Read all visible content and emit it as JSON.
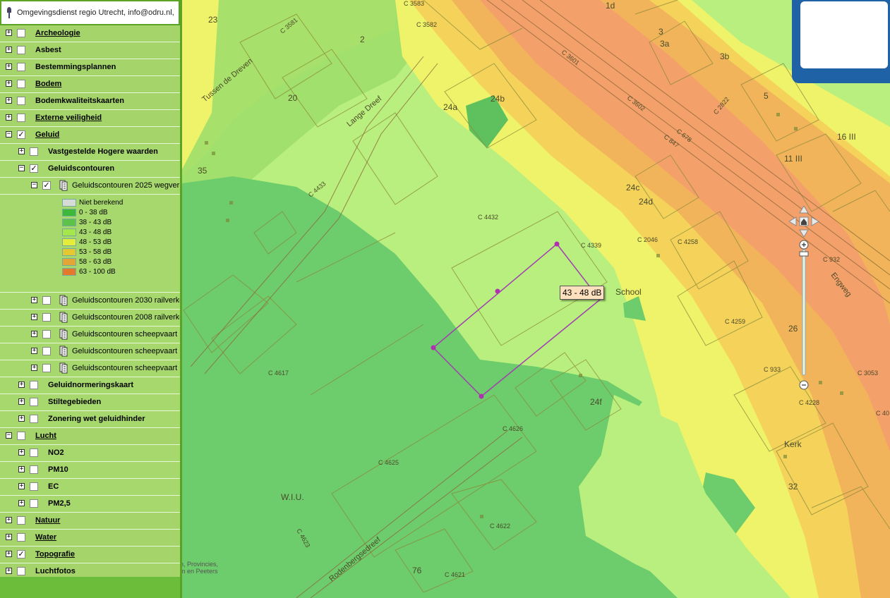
{
  "header": {
    "contact": "Omgevingsdienst regio Utrecht, info@odru.nl,"
  },
  "layers": [
    {
      "label": "Archeologie",
      "level": 0,
      "expand": "+",
      "checked": false,
      "underline": true
    },
    {
      "label": "Asbest",
      "level": 0,
      "expand": "+",
      "checked": false,
      "underline": false
    },
    {
      "label": "Bestemmingsplannen",
      "level": 0,
      "expand": "+",
      "checked": false,
      "underline": false
    },
    {
      "label": "Bodem",
      "level": 0,
      "expand": "+",
      "checked": false,
      "underline": true
    },
    {
      "label": "Bodemkwaliteitskaarten",
      "level": 0,
      "expand": "+",
      "checked": false,
      "underline": false
    },
    {
      "label": "Externe veiligheid",
      "level": 0,
      "expand": "+",
      "checked": false,
      "underline": true
    },
    {
      "label": "Geluid",
      "level": 0,
      "expand": "−",
      "checked": true,
      "underline": true
    },
    {
      "label": "Vastgestelde Hogere waarden",
      "level": 1,
      "expand": "+",
      "checked": false,
      "underline": false
    },
    {
      "label": "Geluidscontouren",
      "level": 1,
      "expand": "−",
      "checked": true,
      "underline": false
    },
    {
      "label": "Geluidscontouren 2025 wegverkeer",
      "level": 2,
      "expand": "−",
      "checked": true,
      "underline": false,
      "icon": true
    }
  ],
  "legend": [
    {
      "label": "Niet berekend",
      "color": "#d6dbd6"
    },
    {
      "label": "0 - 38 dB",
      "color": "#3db83a"
    },
    {
      "label": "38 - 43 dB",
      "color": "#5cc24a"
    },
    {
      "label": "43 - 48 dB",
      "color": "#a5e64a"
    },
    {
      "label": "48 - 53 dB",
      "color": "#e6ec3a"
    },
    {
      "label": "53 - 58 dB",
      "color": "#e3c832"
    },
    {
      "label": "58 - 63 dB",
      "color": "#e3a533"
    },
    {
      "label": "63 - 100 dB",
      "color": "#e37a2b"
    }
  ],
  "layers_after": [
    {
      "label": "Geluidscontouren 2030 railverkeer",
      "level": 2,
      "expand": "+",
      "checked": false,
      "underline": false,
      "icon": true
    },
    {
      "label": "Geluidscontouren 2008 railverkeer",
      "level": 2,
      "expand": "+",
      "checked": false,
      "underline": false,
      "icon": true
    },
    {
      "label": "Geluidscontouren scheepvaart",
      "level": 2,
      "expand": "+",
      "checked": false,
      "underline": false,
      "icon": true
    },
    {
      "label": "Geluidscontouren scheepvaart",
      "level": 2,
      "expand": "+",
      "checked": false,
      "underline": false,
      "icon": true
    },
    {
      "label": "Geluidscontouren scheepvaart",
      "level": 2,
      "expand": "+",
      "checked": false,
      "underline": false,
      "icon": true
    },
    {
      "label": "Geluidnormeringskaart",
      "level": 1,
      "expand": "+",
      "checked": false,
      "underline": false
    },
    {
      "label": "Stiltegebieden",
      "level": 1,
      "expand": "+",
      "checked": false,
      "underline": false
    },
    {
      "label": "Zonering wet geluidhinder",
      "level": 1,
      "expand": "+",
      "checked": false,
      "underline": false
    },
    {
      "label": "Lucht",
      "level": 0,
      "expand": "−",
      "checked": false,
      "underline": true
    },
    {
      "label": "NO2",
      "level": 1,
      "expand": "+",
      "checked": false,
      "underline": false
    },
    {
      "label": "PM10",
      "level": 1,
      "expand": "+",
      "checked": false,
      "underline": false
    },
    {
      "label": "EC",
      "level": 1,
      "expand": "+",
      "checked": false,
      "underline": false
    },
    {
      "label": "PM2,5",
      "level": 1,
      "expand": "+",
      "checked": false,
      "underline": false
    },
    {
      "label": "Natuur",
      "level": 0,
      "expand": "+",
      "checked": false,
      "underline": true
    },
    {
      "label": "Water",
      "level": 0,
      "expand": "+",
      "checked": false,
      "underline": true
    },
    {
      "label": "Topografie",
      "level": 0,
      "expand": "+",
      "checked": true,
      "underline": true
    },
    {
      "label": "Luchtfotos",
      "level": 0,
      "expand": "+",
      "checked": false,
      "underline": false
    }
  ],
  "attribution": {
    "line1": "en, Provincies,",
    "line2": "om en Peeters"
  },
  "measure_tooltip": "43 - 48 dB",
  "map_labels": [
    {
      "text": "23"
    },
    {
      "text": "C 3581"
    },
    {
      "text": "C 3583"
    },
    {
      "text": "C 3582"
    },
    {
      "text": "2"
    },
    {
      "text": "Tussen de Dreven"
    },
    {
      "text": "20"
    },
    {
      "text": "Lange Dreef"
    },
    {
      "text": "24a"
    },
    {
      "text": "24b"
    },
    {
      "text": "35"
    },
    {
      "text": "C 4433"
    },
    {
      "text": "C 4432"
    },
    {
      "text": "C 4339"
    },
    {
      "text": "C 2046"
    },
    {
      "text": "C 4258"
    },
    {
      "text": "24c"
    },
    {
      "text": "24d"
    },
    {
      "text": "School"
    },
    {
      "text": "C 4617"
    },
    {
      "text": "C 4259"
    },
    {
      "text": "26"
    },
    {
      "text": "C 933"
    },
    {
      "text": "C 4626"
    },
    {
      "text": "24f"
    },
    {
      "text": "C 4625"
    },
    {
      "text": "W.I.U."
    },
    {
      "text": "C 4623"
    },
    {
      "text": "C 4622"
    },
    {
      "text": "Rodenbergsedreef"
    },
    {
      "text": "76"
    },
    {
      "text": "C 4621"
    },
    {
      "text": "Kerk"
    },
    {
      "text": "32"
    },
    {
      "text": "C 4228"
    },
    {
      "text": "1d"
    },
    {
      "text": "3"
    },
    {
      "text": "3a"
    },
    {
      "text": "3b"
    },
    {
      "text": "5"
    },
    {
      "text": "C 3601"
    },
    {
      "text": "C 3602"
    },
    {
      "text": "C 678"
    },
    {
      "text": "C 847"
    },
    {
      "text": "C 2822"
    },
    {
      "text": "11 III"
    },
    {
      "text": "16 III"
    },
    {
      "text": "C 932"
    },
    {
      "text": "Engweg"
    },
    {
      "text": "C 3053"
    },
    {
      "text": "C 40"
    }
  ]
}
